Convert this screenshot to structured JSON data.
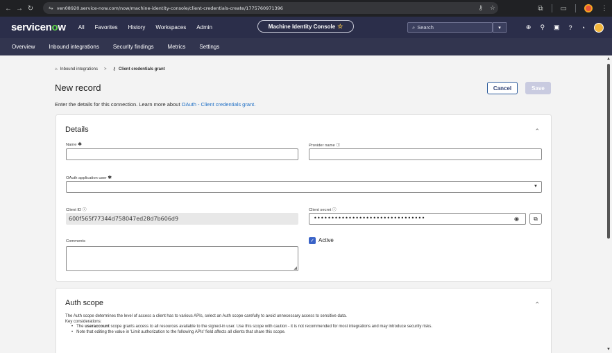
{
  "browser": {
    "url": "ven08920.service-now.com/now/machine-identity-console/client-credentials-create/1775760971396"
  },
  "sn_header": {
    "logo_prefix": "servicen",
    "logo_o": "o",
    "logo_suffix": "w",
    "menu": [
      "All",
      "Favorites",
      "History",
      "Workspaces",
      "Admin"
    ],
    "app_pill": "Machine Identity Console",
    "search_placeholder": "Search"
  },
  "sub_nav": [
    "Overview",
    "Inbound integrations",
    "Security findings",
    "Metrics",
    "Settings"
  ],
  "breadcrumb": {
    "parent": "Inbound integrations",
    "separator": ">",
    "current": "Client credentials grant"
  },
  "page": {
    "title": "New record",
    "intro_text": "Enter the details for this connection. Learn more about ",
    "intro_link": "OAuth - Client credentials grant.",
    "cancel_label": "Cancel",
    "save_label": "Save"
  },
  "details": {
    "title": "Details",
    "name_label": "Name",
    "provider_label": "Provider name",
    "oauth_user_label": "OAuth application user",
    "client_id_label": "Client ID",
    "client_id_value": "600f565f77344d758047ed28d7b606d9",
    "client_secret_label": "Client secret",
    "client_secret_mask": "••••••••••••••••••••••••••••••••",
    "comments_label": "Comments",
    "active_label": "Active"
  },
  "auth_scope": {
    "title": "Auth scope",
    "description": "The Auth scope determines the level of access a client has to various APIs, select an Auth scope carefully to avoid unnecessary access to sensitive data.",
    "key_considerations": "Key considerations:",
    "bullet1_pre": "The ",
    "bullet1_bold": "useraccount",
    "bullet1_post": " scope grants access to all resources available to the signed-in user. Use this scope with caution - it is not recommended for most integrations and may introduce security risks.",
    "bullet2": "Note that editing the value in 'Limit authorization to the following APIs' field affects all clients that share this scope."
  }
}
